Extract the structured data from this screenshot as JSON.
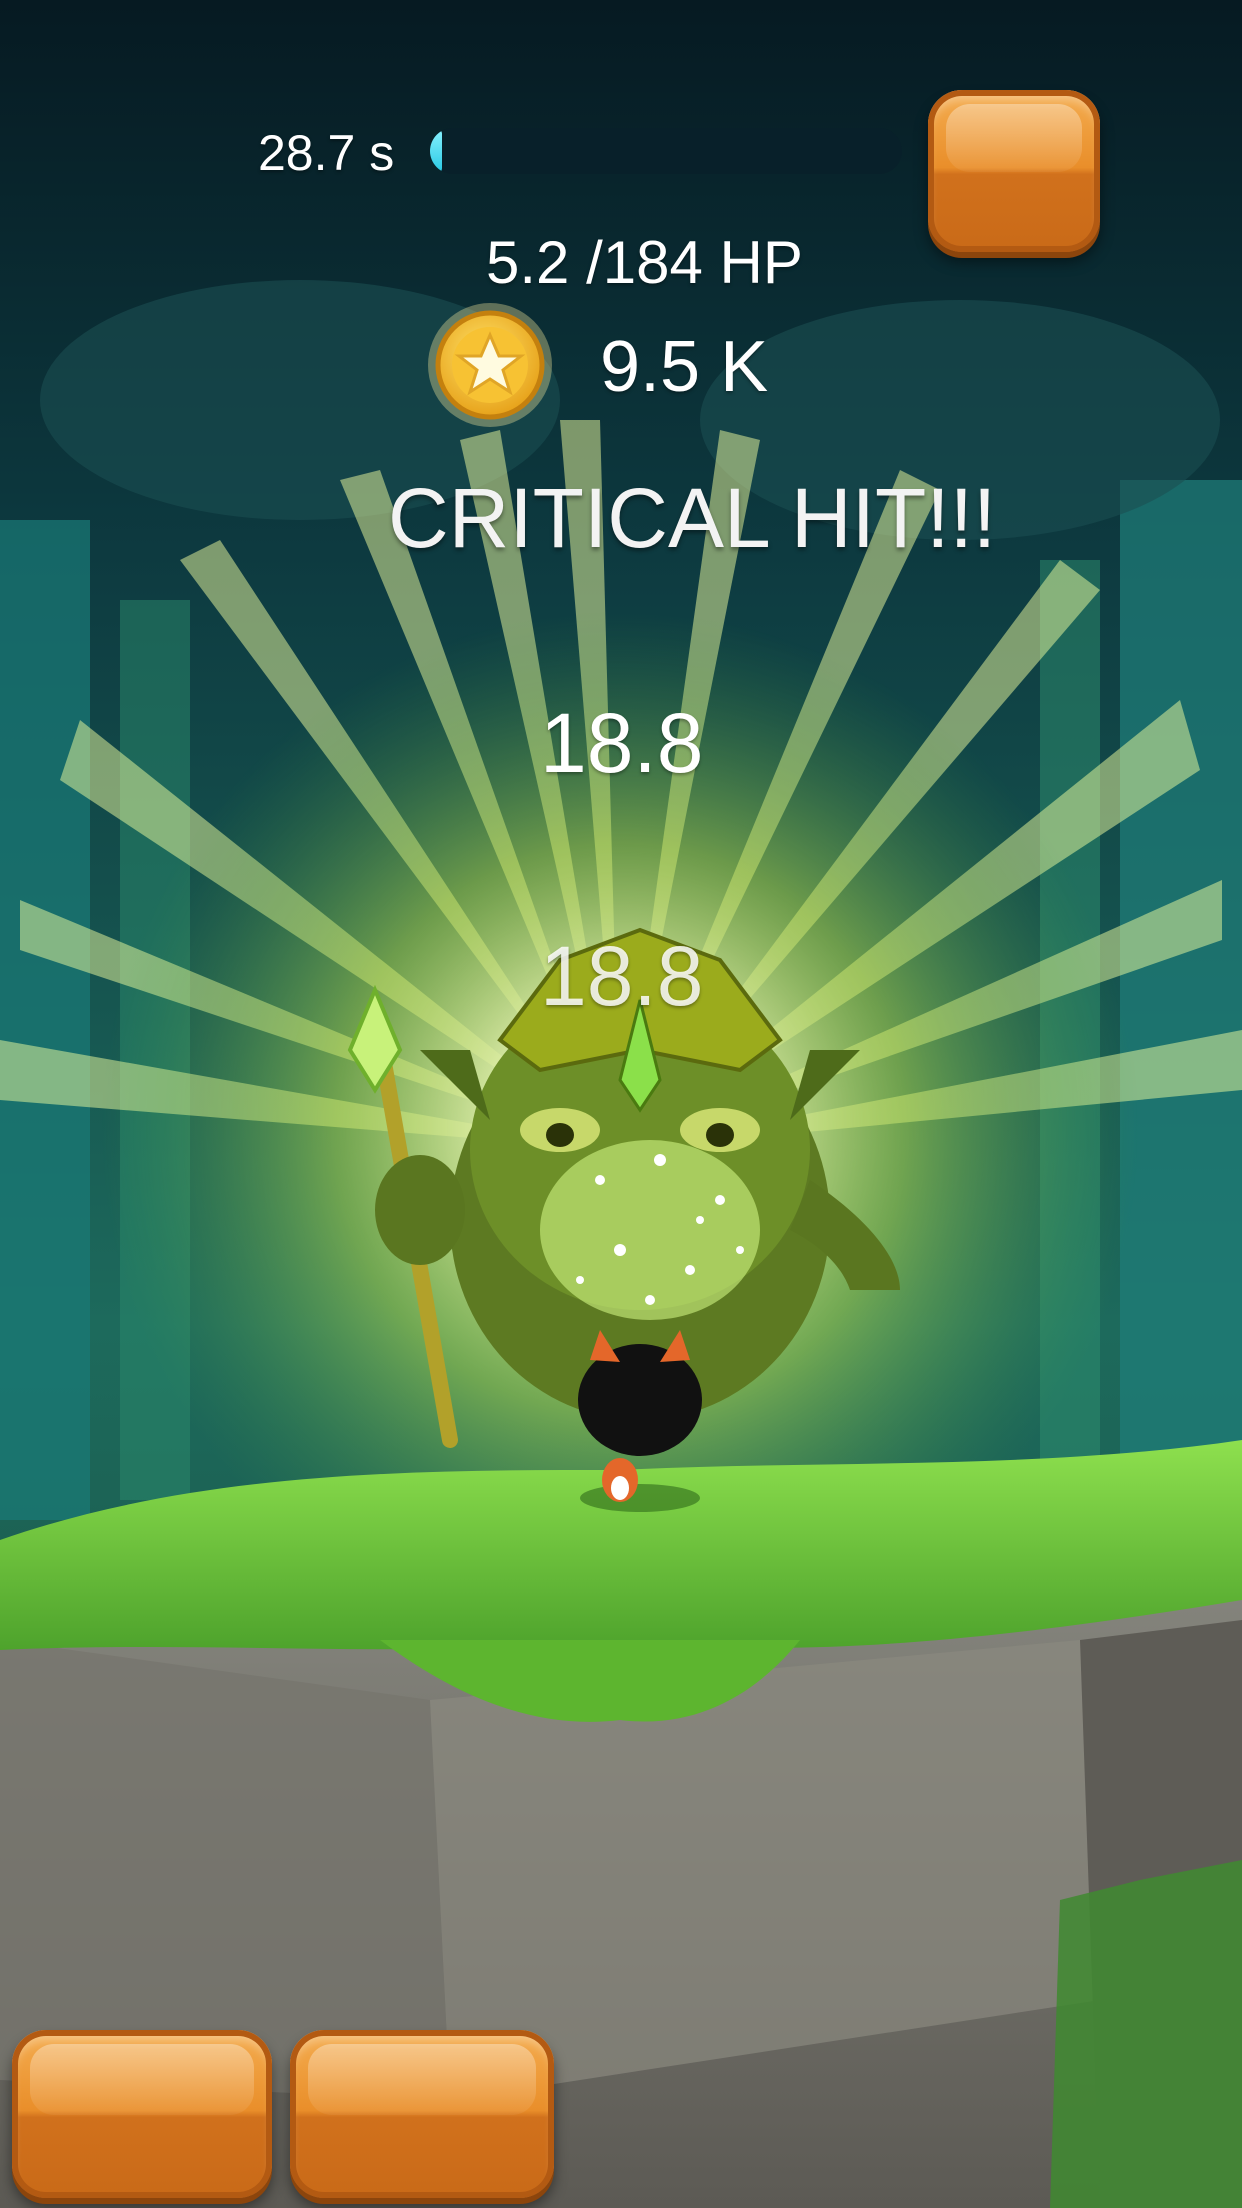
{
  "hud": {
    "timer_text": "28.7 s",
    "timer_fraction": 0.02,
    "hp_text": "5.2 /184 HP",
    "coins_text": "9.5 K",
    "coin_icon": "star-coin-icon"
  },
  "combat": {
    "critical_text": "CRITICAL HIT!!!",
    "damage_numbers": [
      "18.8",
      "18.8"
    ]
  },
  "buttons": {
    "menu": {
      "label": ""
    },
    "action_1": {
      "label": ""
    },
    "action_2": {
      "label": ""
    }
  },
  "colors": {
    "button_orange": "#e98e2a",
    "timer_fill": "#25c8e3",
    "burst": "#f6ffb0",
    "grass": "#6fcf3c"
  }
}
